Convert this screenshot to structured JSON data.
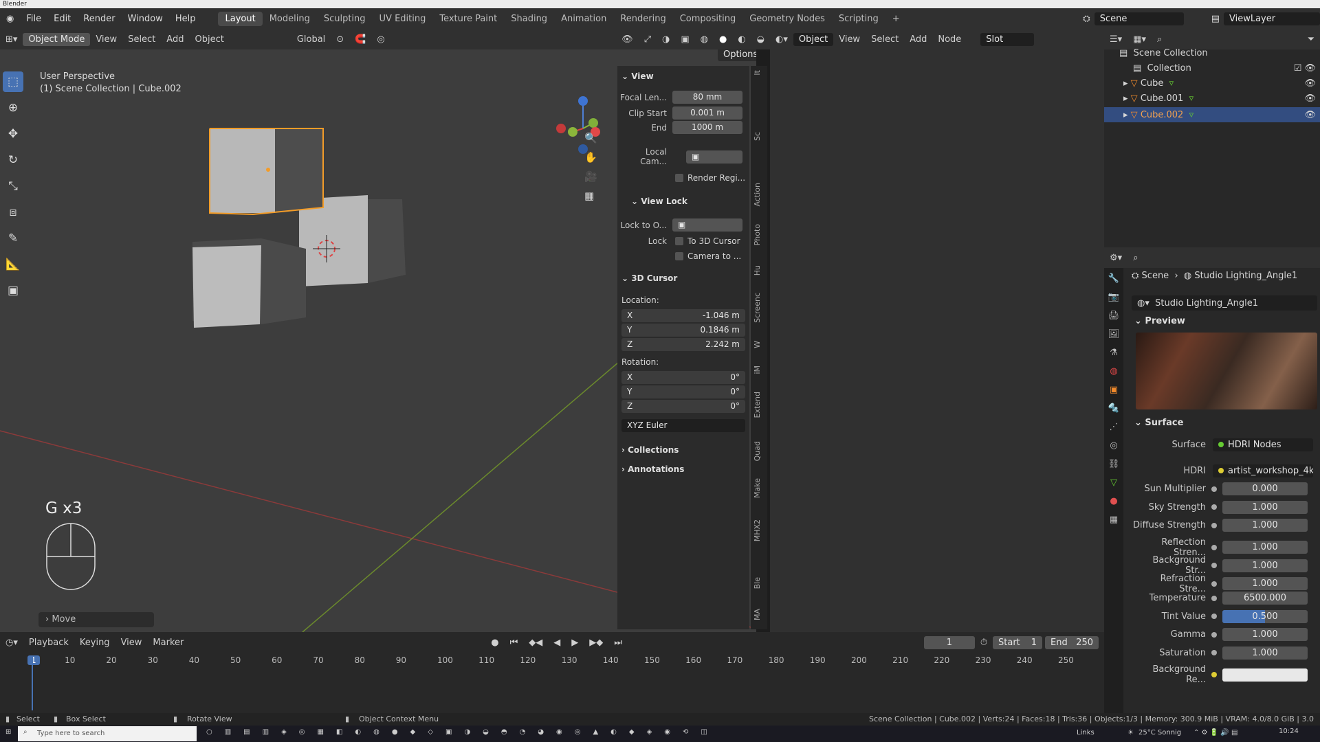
{
  "window_title": "Blender",
  "top_menu": [
    "File",
    "Edit",
    "Render",
    "Window",
    "Help"
  ],
  "workspaces": [
    "Layout",
    "Modeling",
    "Sculpting",
    "UV Editing",
    "Texture Paint",
    "Shading",
    "Animation",
    "Rendering",
    "Compositing",
    "Geometry Nodes",
    "Scripting"
  ],
  "add_workspace": "+",
  "scene": "Scene",
  "view_layer": "ViewLayer",
  "viewport_header": {
    "mode": "Object Mode",
    "menus": [
      "View",
      "Select",
      "Add",
      "Object"
    ],
    "orientation": "Global",
    "options": "Options"
  },
  "viewport": {
    "perspective": "User Perspective",
    "collection_info": "(1) Scene Collection | Cube.002",
    "gesture": "G x3",
    "last_op": "Move"
  },
  "npanel": {
    "view_section": "View",
    "focal_label": "Focal Len...",
    "focal": "80 mm",
    "clip_start_label": "Clip Start",
    "clip_start": "0.001 m",
    "end_label": "End",
    "clip_end": "1000 m",
    "local_cam_label": "Local Cam...",
    "render_region": "Render Regi...",
    "view_lock_section": "View Lock",
    "lock_to_label": "Lock to O...",
    "lock_label": "Lock",
    "to_3d_cursor": "To 3D Cursor",
    "camera_to": "Camera to ...",
    "cursor_section": "3D Cursor",
    "location_label": "Location:",
    "loc": [
      {
        "axis": "X",
        "value": "-1.046 m"
      },
      {
        "axis": "Y",
        "value": "0.1846 m"
      },
      {
        "axis": "Z",
        "value": "2.242 m"
      }
    ],
    "rotation_label": "Rotation:",
    "rot": [
      {
        "axis": "X",
        "value": "0°"
      },
      {
        "axis": "Y",
        "value": "0°"
      },
      {
        "axis": "Z",
        "value": "0°"
      }
    ],
    "rotation_mode": "XYZ Euler",
    "collections": "Collections",
    "annotations": "Annotations"
  },
  "side_tabs": [
    "It",
    "Sc",
    "Action",
    "Photo",
    "Hu",
    "Screenc",
    "W",
    "iM",
    "Extend",
    "Quad",
    "Make",
    "MHX2",
    "Ble",
    "MA"
  ],
  "node_header": {
    "type": "Object",
    "menus": [
      "View",
      "Select",
      "Add",
      "Node"
    ],
    "slot": "Slot"
  },
  "outliner": {
    "root": "Scene Collection",
    "collection": "Collection",
    "items": [
      "Cube",
      "Cube.001",
      "Cube.002"
    ],
    "selected": "Cube.002"
  },
  "properties": {
    "breadcrumb": [
      "Scene",
      "Studio Lighting_Angle1"
    ],
    "world_name": "Studio Lighting_Angle1",
    "preview": "Preview",
    "surface_section": "Surface",
    "surface_label": "Surface",
    "surface_value": "HDRI Nodes",
    "hdri_label": "HDRI",
    "hdri_value": "artist_workshop_4k....",
    "params": [
      {
        "label": "Sun Multiplier",
        "value": "0.000"
      },
      {
        "label": "Sky Strength",
        "value": "1.000"
      },
      {
        "label": "Diffuse Strength",
        "value": "1.000"
      },
      {
        "label": "Reflection Stren...",
        "value": "1.000"
      },
      {
        "label": "Background Str...",
        "value": "1.000"
      },
      {
        "label": "Refraction Stre...",
        "value": "1.000"
      },
      {
        "label": "Temperature",
        "value": "6500.000"
      },
      {
        "label": "Tint Value",
        "value": "0.500"
      },
      {
        "label": "Gamma",
        "value": "1.000"
      },
      {
        "label": "Saturation",
        "value": "1.000"
      },
      {
        "label": "Background Re...",
        "value": ""
      }
    ],
    "tint_fill": 0.5
  },
  "timeline": {
    "menus": [
      "Playback",
      "Keying",
      "View",
      "Marker"
    ],
    "current_frame": "1",
    "start_label": "Start",
    "start": "1",
    "end_label": "End",
    "end": "250",
    "ticks": [
      "1",
      "10",
      "20",
      "30",
      "40",
      "50",
      "60",
      "70",
      "80",
      "90",
      "100",
      "110",
      "120",
      "130",
      "140",
      "150",
      "160",
      "170",
      "180",
      "190",
      "200",
      "210",
      "220",
      "230",
      "240",
      "250"
    ]
  },
  "status": {
    "select": "Select",
    "box_select": "Box Select",
    "rotate_view": "Rotate View",
    "context_menu": "Object Context Menu",
    "stats": "Scene Collection | Cube.002 | Verts:24 | Faces:18 | Tris:36 | Objects:1/3 | Memory: 300.9 MiB | VRAM: 4.0/8.0 GiB | 3.0"
  },
  "taskbar": {
    "search": "Type here to search",
    "links": "Links",
    "weather": "25°C Sonnig",
    "time": "10:24"
  }
}
